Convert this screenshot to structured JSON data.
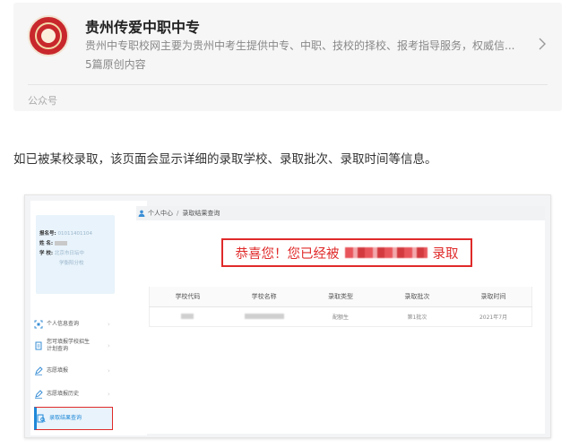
{
  "account": {
    "name": "贵州传爱中职中专",
    "description": "贵州中专职校网主要为贵州中考生提供中专、中职、技校的择校、报考指导服务，权威信...",
    "article_count": "5篇原创内容",
    "type_label": "公众号"
  },
  "intro_text": "如已被某校录取，该页面会显示详细的录取学校、录取批次、录取时间等信息。",
  "screenshot": {
    "breadcrumb": {
      "home": "个人中心",
      "separator": "/",
      "current": "录取结果查询"
    },
    "profile": {
      "reg_label": "报名号:",
      "reg_value": "01011401104",
      "name_label": "姓   名:",
      "school_label": "学   校:",
      "school_value_line1": "北京市日坛中",
      "school_value_line2": "学衡阳分校"
    },
    "sidebar": {
      "items": [
        {
          "label": "个人信息查询",
          "icon": "scan-icon"
        },
        {
          "label": "您可填报学校招生计划查询",
          "icon": "document-icon"
        },
        {
          "label": "志愿填报",
          "icon": "edit-icon"
        },
        {
          "label": "志愿填报历史",
          "icon": "edit-icon"
        },
        {
          "label": "录取结果查询",
          "icon": "search-doc-icon"
        }
      ]
    },
    "congrats": {
      "prefix": "恭喜您！您已经被",
      "suffix": "录取"
    },
    "table": {
      "headers": [
        "学校代码",
        "学校名称",
        "录取类型",
        "录取批次",
        "录取时间"
      ],
      "row": {
        "type": "配额生",
        "batch": "第1批次",
        "time": "2021年7月"
      }
    },
    "colors": {
      "highlight_red": "#e02a2a",
      "active_blue": "#1e88d8"
    }
  }
}
